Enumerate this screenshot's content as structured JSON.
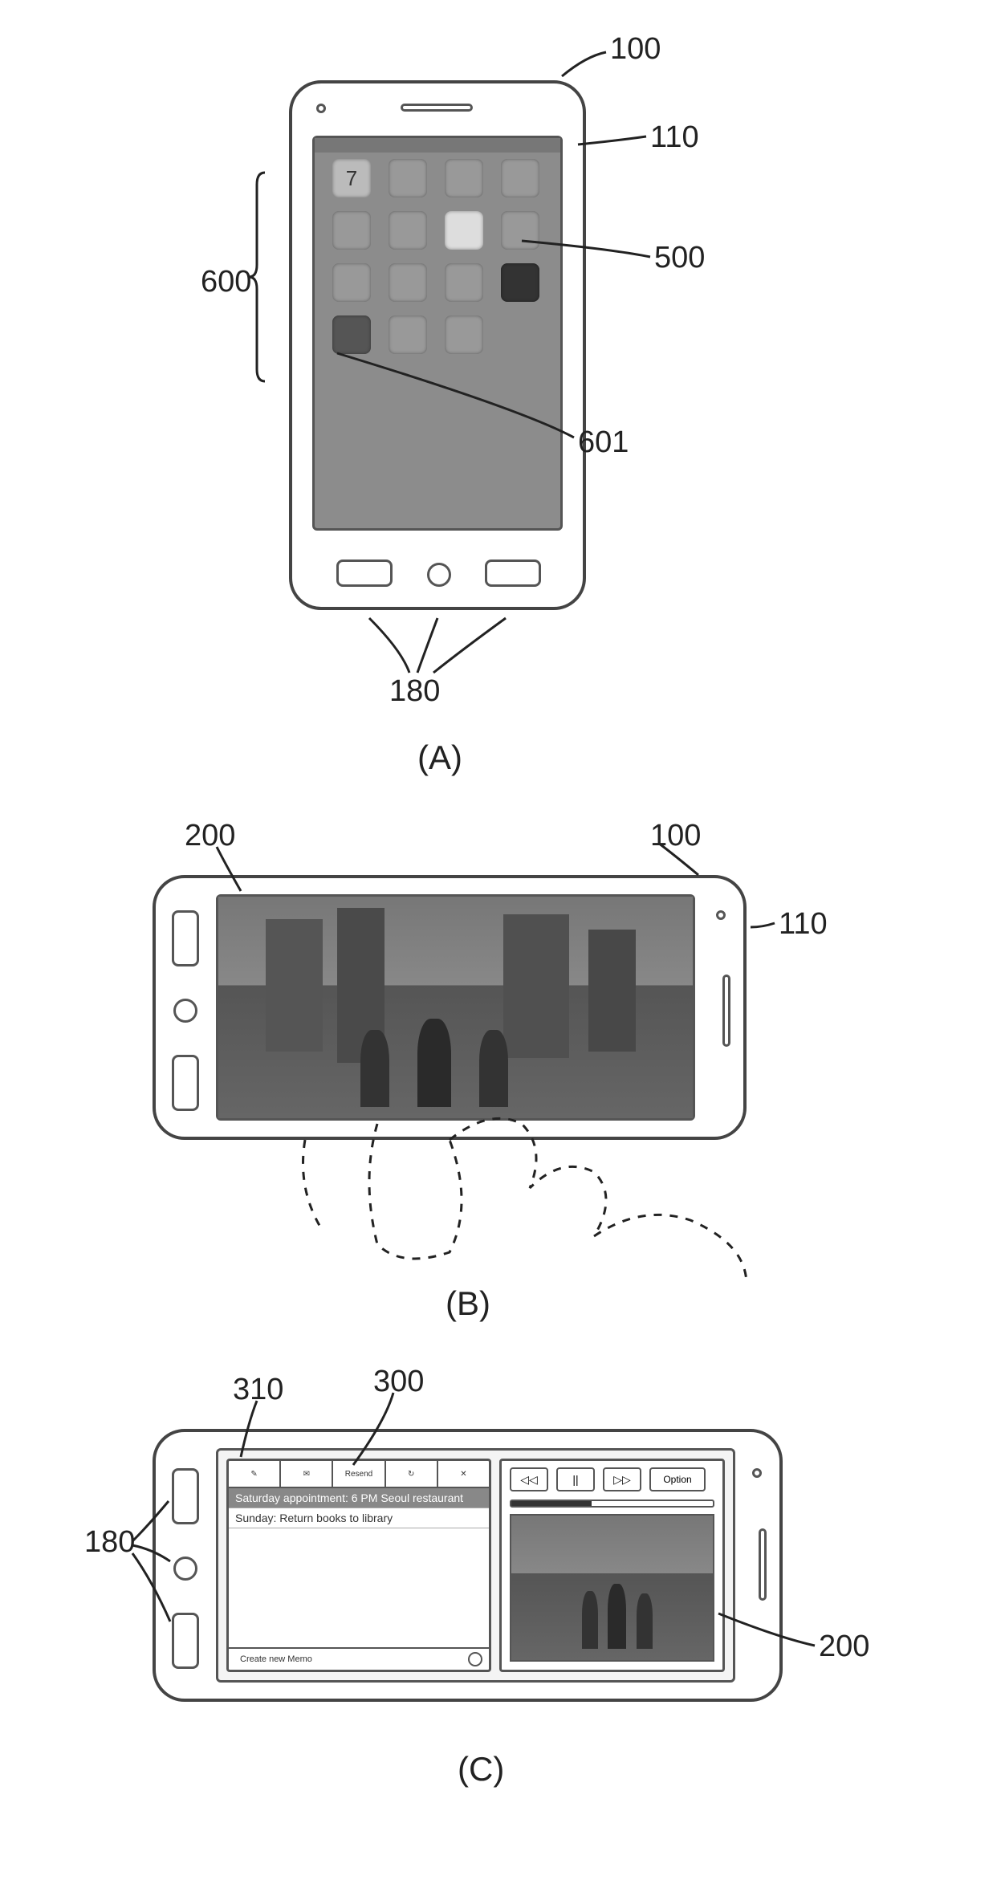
{
  "labels": {
    "l100": "100",
    "l110": "110",
    "l600": "600",
    "l500": "500",
    "l601": "601",
    "l180": "180",
    "l200": "200",
    "l300": "300",
    "l310": "310"
  },
  "figLabels": {
    "A": "(A)",
    "B": "(B)",
    "C": "(C)"
  },
  "figA": {
    "appGrid": [
      [
        "7",
        "user",
        "globe",
        "grid"
      ],
      [
        "lines",
        "circle",
        "cam",
        "cal"
      ],
      [
        "blank",
        "book",
        "f",
        "dark"
      ],
      [
        "photo",
        "cloud",
        "eye",
        ""
      ]
    ],
    "calendarDay": "7"
  },
  "figC": {
    "controls": {
      "prev": "◁◁",
      "pause": "||",
      "next": "▷▷",
      "option": "Option"
    },
    "toolbar": [
      "✎",
      "✉",
      "✉",
      "↻",
      "✕"
    ],
    "toolbarLabels": [
      "",
      "",
      "Resend",
      "",
      ""
    ],
    "memo": {
      "line1": "Saturday appointment: 6 PM Seoul restaurant",
      "line2": "Sunday: Return books to library",
      "create": "Create new Memo"
    }
  }
}
